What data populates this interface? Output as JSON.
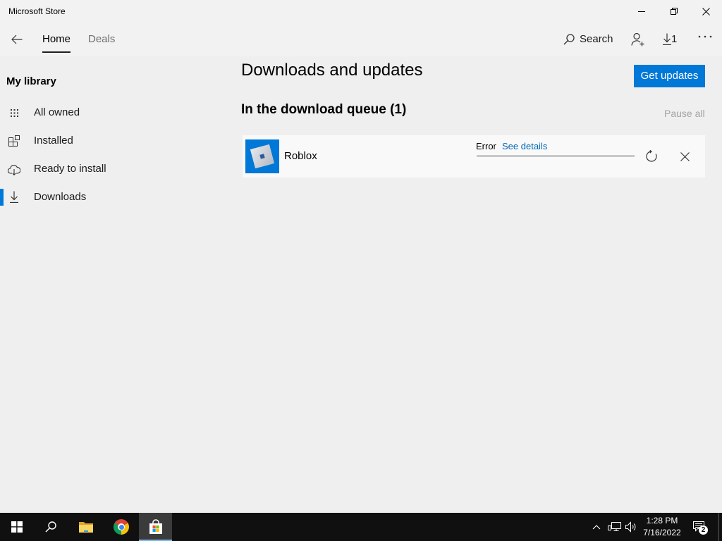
{
  "colors": {
    "accent": "#0078d7",
    "link": "#0067b8",
    "taskbar": "#101010"
  },
  "window": {
    "title": "Microsoft Store",
    "controls": [
      "minimize-icon",
      "restore-icon",
      "close-icon"
    ]
  },
  "nav": {
    "back_icon": "back-arrow-icon",
    "tabs": [
      {
        "label": "Home",
        "active": true
      },
      {
        "label": "Deals",
        "active": false
      }
    ],
    "search": {
      "icon": "search-icon",
      "label": "Search"
    },
    "account_icon": "add-user-icon",
    "downloads": {
      "icon": "download-icon",
      "count": "1"
    },
    "more_icon": "more-icon"
  },
  "sidebar": {
    "heading": "My library",
    "items": [
      {
        "label": "All owned",
        "icon": "grid-icon",
        "selected": false
      },
      {
        "label": "Installed",
        "icon": "installed-apps-icon",
        "selected": false
      },
      {
        "label": "Ready to install",
        "icon": "cloud-download-icon",
        "selected": false
      },
      {
        "label": "Downloads",
        "icon": "download-icon",
        "selected": true
      }
    ]
  },
  "main": {
    "title": "Downloads and updates",
    "get_updates_label": "Get updates",
    "queue_heading": "In the download queue (1)",
    "pause_all_label": "Pause all",
    "queue": [
      {
        "name": "Roblox",
        "icon": "roblox-logo-icon",
        "status": "Error",
        "details_link": "See details",
        "actions": [
          "retry-icon",
          "cancel-icon"
        ]
      }
    ]
  },
  "taskbar": {
    "pinned": [
      "windows-start-icon",
      "search-icon",
      "file-explorer-icon",
      "chrome-icon",
      "microsoft-store-icon"
    ],
    "active_app": "microsoft-store-icon",
    "tray_icons": [
      "chevron-up-icon",
      "network-icon",
      "volume-icon",
      "notification-icon"
    ],
    "time": "1:28 PM",
    "date": "7/16/2022",
    "notification_count": "2"
  }
}
